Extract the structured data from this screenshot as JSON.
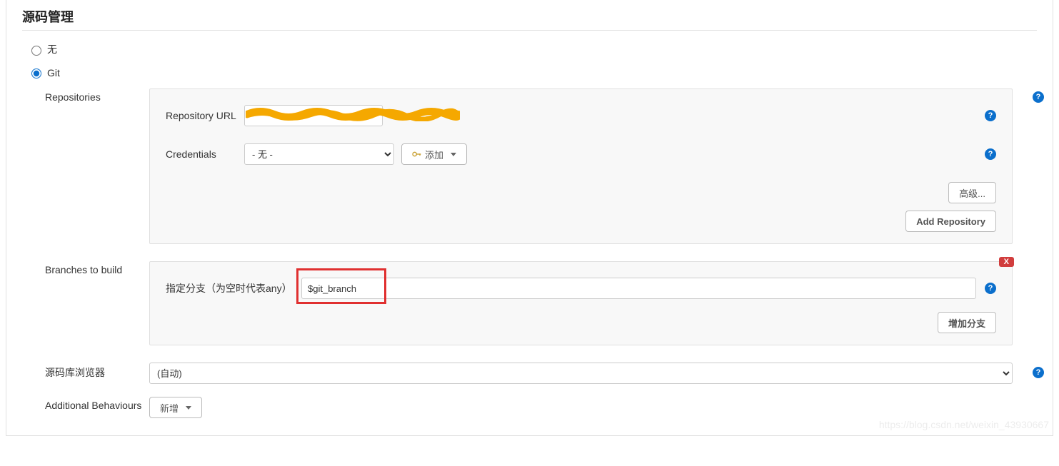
{
  "section_title": "源码管理",
  "scm_options": {
    "none_label": "无",
    "git_label": "Git",
    "selected": "git"
  },
  "repositories": {
    "label": "Repositories",
    "repo_url_label": "Repository URL",
    "repo_url_value": "",
    "credentials_label": "Credentials",
    "credentials_selected": "- 无 -",
    "add_button": "添加",
    "advanced_button": "高级...",
    "add_repo_button": "Add Repository"
  },
  "branches": {
    "label": "Branches to build",
    "branch_label": "指定分支（为空时代表any）",
    "branch_value": "$git_branch",
    "delete_label": "X",
    "add_branch_button": "增加分支"
  },
  "browser": {
    "label": "源码库浏览器",
    "selected": "(自动)"
  },
  "behaviours": {
    "label": "Additional Behaviours",
    "add_button": "新增"
  },
  "watermark": "https://blog.csdn.net/weixin_43930667"
}
